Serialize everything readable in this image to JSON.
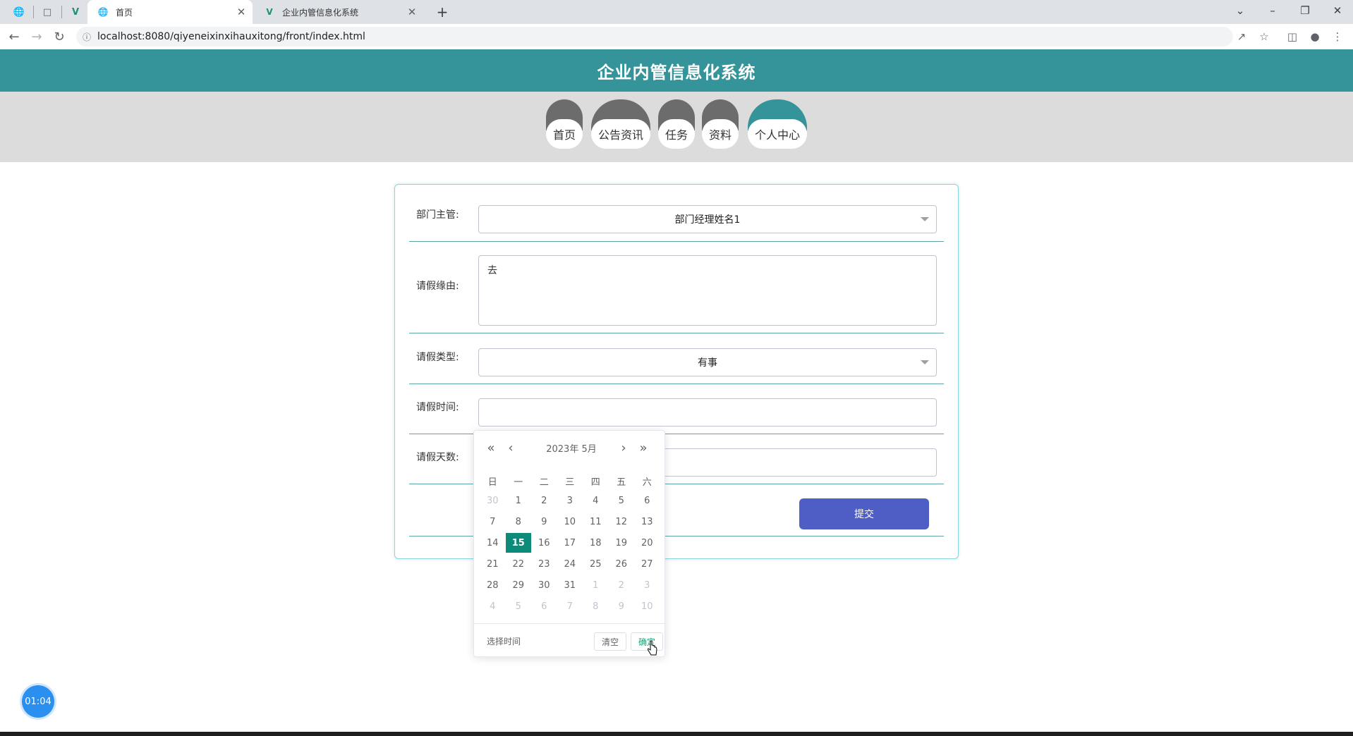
{
  "browser": {
    "tabs": [
      {
        "title": "首页",
        "active": true
      },
      {
        "title": "企业内管信息化系统",
        "active": false
      }
    ],
    "url": "localhost:8080/qiyeneixinxihauxitong/front/index.html"
  },
  "site": {
    "title": "企业内管信息化系统",
    "nav": [
      {
        "label": "首页",
        "active": false
      },
      {
        "label": "公告资讯",
        "active": false
      },
      {
        "label": "任务",
        "active": false
      },
      {
        "label": "资料",
        "active": false
      },
      {
        "label": "个人中心",
        "active": true
      }
    ]
  },
  "form": {
    "manager_label": "部门主管:",
    "manager_value": "部门经理姓名1",
    "reason_label": "请假缘由:",
    "reason_value": "去",
    "type_label": "请假类型:",
    "type_value": "有事",
    "time_label": "请假时间:",
    "time_value": "",
    "days_label": "请假天数:",
    "days_value": "",
    "submit_label": "提交"
  },
  "datepicker": {
    "year_label": "2023年",
    "month_label": "5月",
    "weekdays": [
      "日",
      "一",
      "二",
      "三",
      "四",
      "五",
      "六"
    ],
    "weeks": [
      [
        {
          "d": "30",
          "dim": true
        },
        {
          "d": "1"
        },
        {
          "d": "2"
        },
        {
          "d": "3"
        },
        {
          "d": "4"
        },
        {
          "d": "5"
        },
        {
          "d": "6"
        }
      ],
      [
        {
          "d": "7"
        },
        {
          "d": "8"
        },
        {
          "d": "9"
        },
        {
          "d": "10"
        },
        {
          "d": "11"
        },
        {
          "d": "12"
        },
        {
          "d": "13"
        }
      ],
      [
        {
          "d": "14"
        },
        {
          "d": "15",
          "selected": true
        },
        {
          "d": "16"
        },
        {
          "d": "17"
        },
        {
          "d": "18"
        },
        {
          "d": "19"
        },
        {
          "d": "20"
        }
      ],
      [
        {
          "d": "21"
        },
        {
          "d": "22"
        },
        {
          "d": "23"
        },
        {
          "d": "24"
        },
        {
          "d": "25"
        },
        {
          "d": "26"
        },
        {
          "d": "27"
        }
      ],
      [
        {
          "d": "28"
        },
        {
          "d": "29"
        },
        {
          "d": "30"
        },
        {
          "d": "31"
        },
        {
          "d": "1",
          "dim": true
        },
        {
          "d": "2",
          "dim": true
        },
        {
          "d": "3",
          "dim": true
        }
      ],
      [
        {
          "d": "4",
          "dim": true
        },
        {
          "d": "5",
          "dim": true
        },
        {
          "d": "6",
          "dim": true
        },
        {
          "d": "7",
          "dim": true
        },
        {
          "d": "8",
          "dim": true
        },
        {
          "d": "9",
          "dim": true
        },
        {
          "d": "10",
          "dim": true
        }
      ]
    ],
    "select_time_label": "选择时间",
    "clear_label": "清空",
    "confirm_label": "确定"
  },
  "timer": {
    "value": "01:04"
  },
  "colors": {
    "header": "#35939a",
    "nav_band": "#dcdcdc",
    "submit": "#4e5ec5",
    "selected_day": "#0c8a7a"
  }
}
